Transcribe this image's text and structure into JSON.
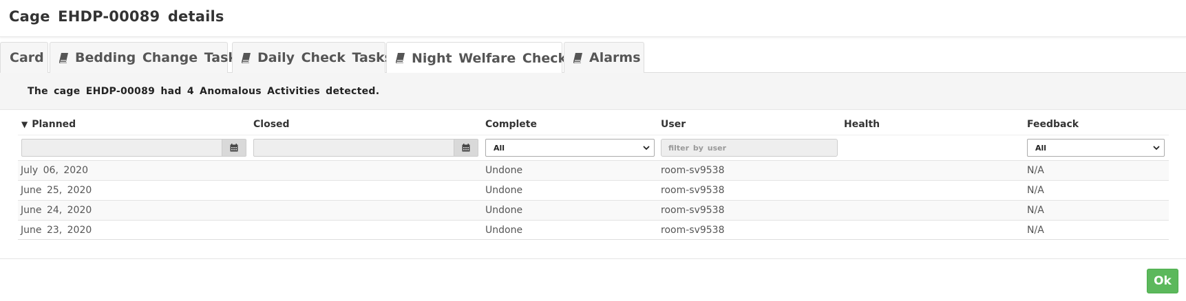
{
  "modal": {
    "title": "Cage  EHDP-00089  details"
  },
  "tabs": [
    {
      "label": "Card",
      "icon": "none",
      "active": false
    },
    {
      "label": "Bedding Change Tasks",
      "icon": "book-icon",
      "active": false
    },
    {
      "label": "Daily Check Tasks",
      "icon": "book-icon",
      "active": false
    },
    {
      "label": "Night Welfare Checks",
      "icon": "book-icon",
      "active": true
    },
    {
      "label": "Alarms",
      "icon": "book-icon",
      "active": false
    }
  ],
  "alert": {
    "text": "The cage EHDP-00089 had 4 Anomalous Activities detected."
  },
  "table": {
    "sort_indicator": "▼",
    "columns": [
      "Planned",
      "Closed",
      "Complete",
      "User",
      "Health",
      "Feedback"
    ],
    "filters": {
      "planned_value": "",
      "closed_value": "",
      "complete_selected": "All",
      "user_placeholder": "filter by user",
      "feedback_selected": "All"
    },
    "rows": [
      {
        "planned": "July 06, 2020",
        "closed": "",
        "complete": "Undone",
        "user": "room-sv9538",
        "health": "",
        "feedback": "N/A"
      },
      {
        "planned": "June 25, 2020",
        "closed": "",
        "complete": "Undone",
        "user": "room-sv9538",
        "health": "",
        "feedback": "N/A"
      },
      {
        "planned": "June 24, 2020",
        "closed": "",
        "complete": "Undone",
        "user": "room-sv9538",
        "health": "",
        "feedback": "N/A"
      },
      {
        "planned": "June 23, 2020",
        "closed": "",
        "complete": "Undone",
        "user": "room-sv9538",
        "health": "",
        "feedback": "N/A"
      }
    ]
  },
  "footer": {
    "ok_label": "Ok"
  },
  "colors": {
    "ok_button": "#5cb85c",
    "panel_bg": "#f5f5f5",
    "tab_bg": "#f6f6f6"
  }
}
